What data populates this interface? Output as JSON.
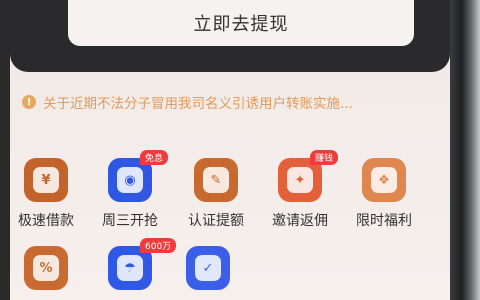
{
  "withdraw_button": {
    "label": "立即去提现"
  },
  "notice": {
    "icon": "warning-icon",
    "text": "关于近期不法分子冒用我司名义引诱用户转账实施..."
  },
  "grid": {
    "items": [
      {
        "label": "极速借款",
        "icon": "money-bag-icon",
        "color": "#c4622b",
        "badge": ""
      },
      {
        "label": "周三开抢",
        "icon": "gift-icon",
        "color": "#2f57e2",
        "badge": "免息"
      },
      {
        "label": "认证提额",
        "icon": "pencil-bag-icon",
        "color": "#c8692f",
        "badge": ""
      },
      {
        "label": "邀请返佣",
        "icon": "gift-box-icon",
        "color": "#e3603b",
        "badge": "赚钱"
      },
      {
        "label": "限时福利",
        "icon": "gift-bag-icon",
        "color": "#e0874f",
        "badge": ""
      },
      {
        "label": "",
        "icon": "percent-icon",
        "color": "#c96a31",
        "badge": ""
      },
      {
        "label": "",
        "icon": "umbrella-icon",
        "color": "#3158e4",
        "badge": "600万"
      },
      {
        "label": "",
        "icon": "calendar-check-icon",
        "color": "#3b5fe8",
        "badge": ""
      }
    ]
  }
}
